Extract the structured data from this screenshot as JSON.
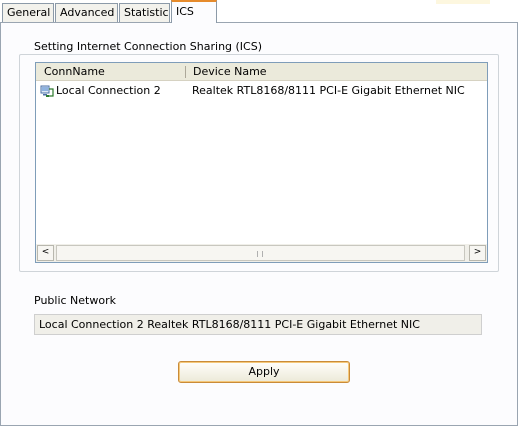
{
  "tabs": [
    {
      "label": "General"
    },
    {
      "label": "Advanced"
    },
    {
      "label": "Statistics"
    },
    {
      "label": "ICS",
      "active": true
    }
  ],
  "section_title": "Setting Internet Connection Sharing (ICS)",
  "list": {
    "columns": [
      "ConnName",
      "Device Name"
    ],
    "rows": [
      {
        "conn_name": "Local Connection 2",
        "device_name": "Realtek RTL8168/8111 PCI-E Gigabit Ethernet NIC"
      }
    ],
    "scroll_left_glyph": "<",
    "scroll_right_glyph": ">"
  },
  "public_network": {
    "label": "Public Network",
    "value": "Local Connection 2 Realtek RTL8168/8111 PCI-E Gigabit Ethernet NIC"
  },
  "buttons": {
    "apply": "Apply"
  },
  "colors": {
    "active_tab_accent": "#e68b2c",
    "panel_bg": "#fcfcfe",
    "button_border": "#c98b39"
  },
  "icons": {
    "connection": "network-connection-icon"
  }
}
